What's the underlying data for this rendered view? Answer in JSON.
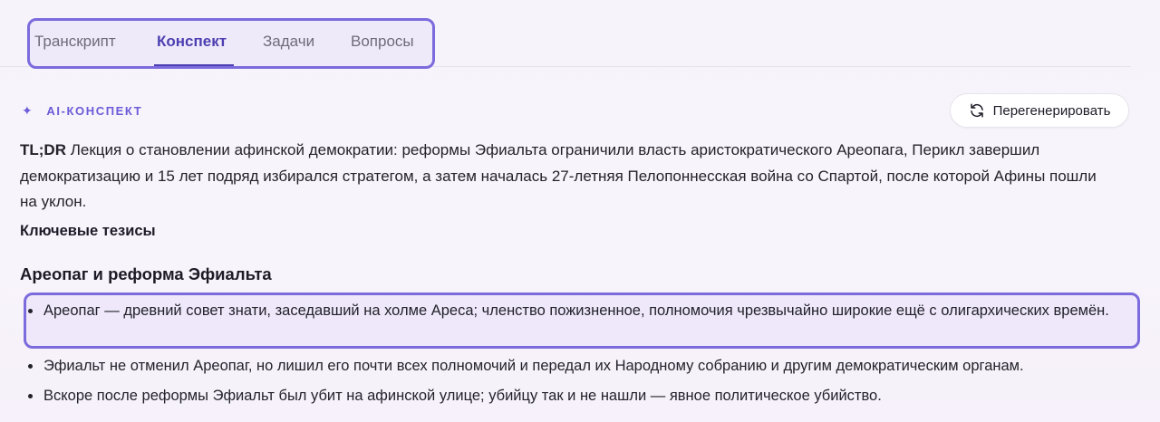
{
  "tabs": [
    {
      "label": "Транскрипт",
      "active": false
    },
    {
      "label": "Конспект",
      "active": true
    },
    {
      "label": "Задачи",
      "active": false
    },
    {
      "label": "Вопросы",
      "active": false
    }
  ],
  "summary": {
    "ai_label": "AI-КОНСПЕКТ",
    "regenerate_label": "Перегенерировать",
    "tldr_prefix": "TL;DR",
    "tldr_text": " Лекция о становлении афинской демократии: реформы Эфиальта ограничили власть аристократического Ареопага, Перикл завершил демократизацию и 15 лет подряд избирался стратегом, а затем началась 27-летняя Пелопоннесская война со Спартой, после которой Афины пошли на уклон.",
    "key_title": "Ключевые тезисы",
    "section_title": "Ареопаг и реформа Эфиальта",
    "bullets": [
      "Ареопаг — древний совет знати, заседавший на холме Ареса; членство пожизненное, полномочия чрезвычайно широкие ещё с олигархических времён.",
      "Эфиальт не отменил Ареопаг, но лишил его почти всех полномочий и передал их Народному собранию и другим демократическим органам.",
      "Вскоре после реформы Эфиальт был убит на афинской улице; убийцу так и не нашли — явное политическое убийство."
    ]
  },
  "icons": {
    "sparkle": "sparkle-icon",
    "regenerate": "refresh-icon"
  },
  "colors": {
    "accent": "#4c3fb1",
    "highlight_border": "#7b6bdc"
  }
}
